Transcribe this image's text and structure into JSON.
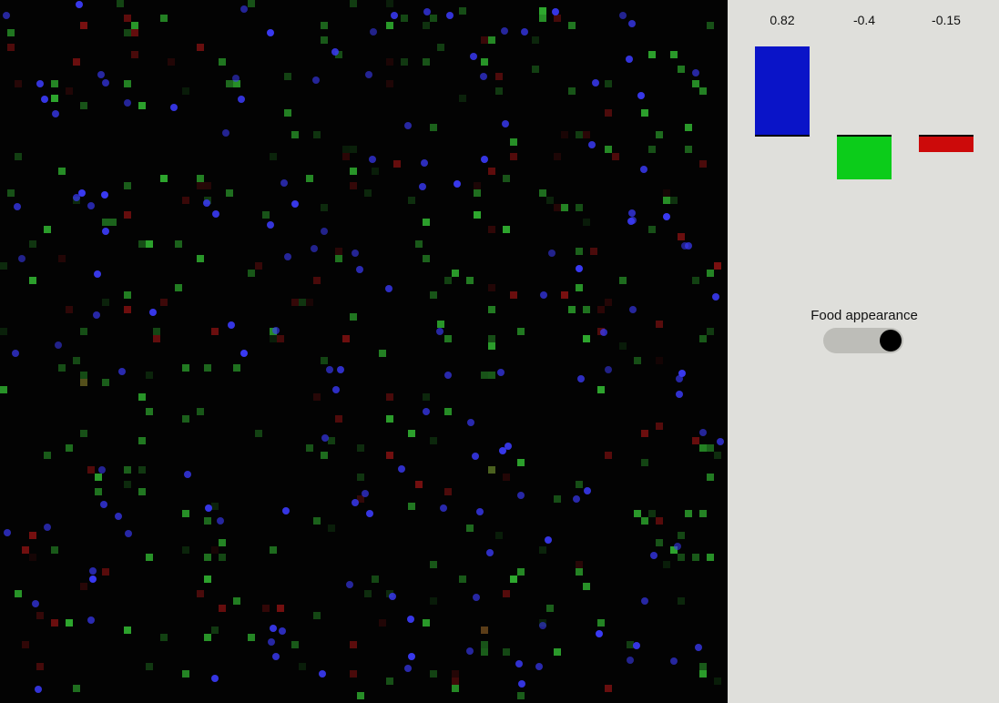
{
  "bars": [
    {
      "label": "0.82",
      "value": 0.82,
      "color": "#0a14c8"
    },
    {
      "label": "-0.4",
      "value": -0.4,
      "color": "#0ccc1a"
    },
    {
      "label": "-0.15",
      "value": -0.15,
      "color": "#cc0a0a"
    }
  ],
  "toggle": {
    "label": "Food appearance",
    "state": "on"
  },
  "colors": {
    "background": "#030303",
    "panel": "#dfdfdb",
    "agent": "#3a3af5",
    "food_green": "#2ea82e",
    "food_red": "#7a1010"
  }
}
